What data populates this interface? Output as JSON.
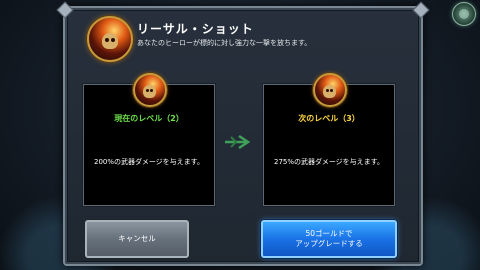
{
  "ability": {
    "title": "リーサル・ショット",
    "description": "あなたのヒーローが標的に対し強力な一撃を放ちます。",
    "icon": "skull-fire-icon"
  },
  "current_level": {
    "title": "現在のレベル（2）",
    "effect": "200%の武器ダメージを与えます。"
  },
  "next_level": {
    "title": "次のレベル（3）",
    "effect": "275%の武器ダメージを与えます。"
  },
  "buttons": {
    "cancel_label": "キャンセル",
    "upgrade_label": "50ゴールドで\nアップグレードする"
  },
  "colors": {
    "current_level": "#6ee04a",
    "next_level": "#ffd640",
    "upgrade_button": "#1a72e6",
    "cancel_button": "#67717c",
    "arrow": "#3fa05a"
  }
}
